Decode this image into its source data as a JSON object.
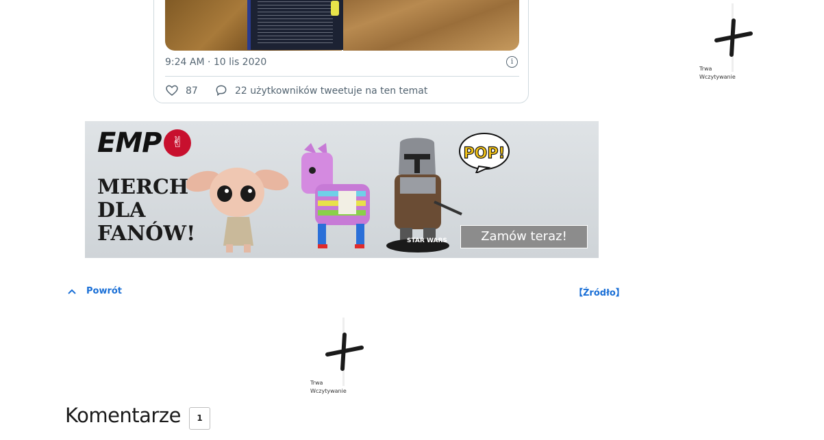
{
  "tweet": {
    "time": "9:24 AM · 10 lis 2020",
    "likes": "87",
    "reply_text": "22 użytkowników tweetuje na ten temat",
    "info_icon": "i"
  },
  "loaders": [
    {
      "line1": "Trwa",
      "line2": "Wczytywanie"
    },
    {
      "line1": "Trwa",
      "line2": "Wczytywanie"
    }
  ],
  "banner": {
    "brand": "EMP",
    "headline": [
      "MERCH",
      "DLA",
      "FANÓW!"
    ],
    "cta": "Zamów teraz!",
    "pop_label": "POP!",
    "starwars_label": "STAR WARS"
  },
  "nav": {
    "back": "Powrót",
    "source": "【Źródło】"
  },
  "comments": {
    "title": "Komentarze",
    "count": "1"
  },
  "colors": {
    "link": "#1a6fd6",
    "muted": "#536471",
    "emp_red": "#c8102e"
  }
}
